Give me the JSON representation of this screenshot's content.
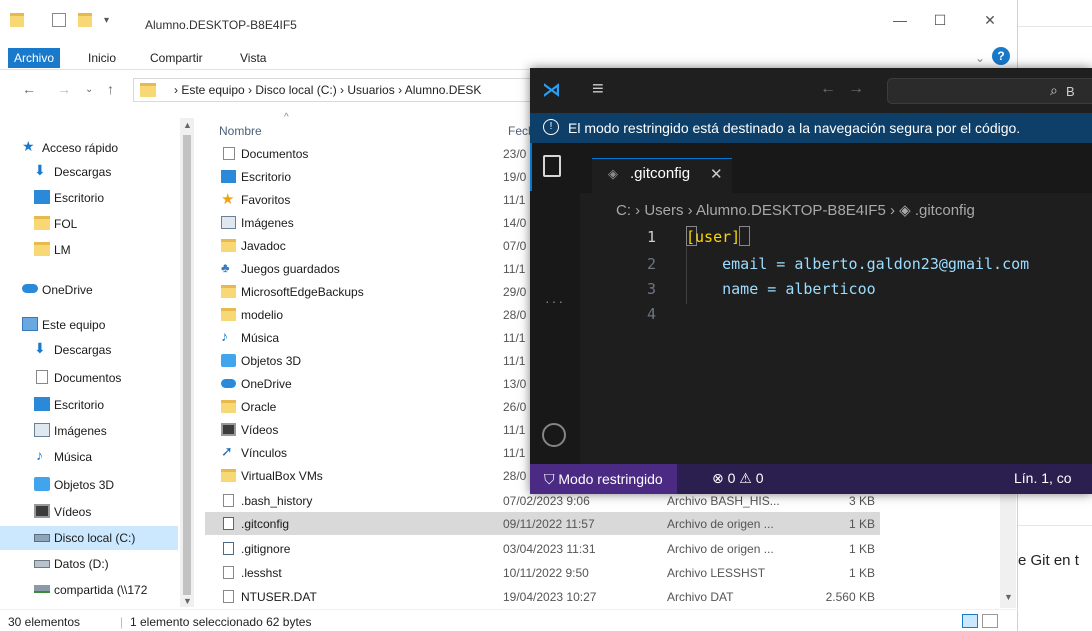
{
  "explorer": {
    "title": "Alumno.DESKTOP-B8E4IF5",
    "ribbon_tabs": [
      "Archivo",
      "Inicio",
      "Compartir",
      "Vista"
    ],
    "address_path": "›  Este equipo  ›  Disco local (C:)  ›  Usuarios  ›  Alumno.DESK",
    "nav": [
      {
        "label": "Acceso rápido",
        "icon": "star-icon"
      },
      {
        "label": "Descargas",
        "icon": "download-icon"
      },
      {
        "label": "Escritorio",
        "icon": "desktop-icon"
      },
      {
        "label": "FOL",
        "icon": "folder-icon"
      },
      {
        "label": "LM",
        "icon": "folder-icon"
      },
      {
        "label": "OneDrive",
        "icon": "cloud-icon"
      },
      {
        "label": "Este equipo",
        "icon": "computer-icon"
      },
      {
        "label": "Descargas",
        "icon": "download-icon"
      },
      {
        "label": "Documentos",
        "icon": "document-icon"
      },
      {
        "label": "Escritorio",
        "icon": "desktop-icon"
      },
      {
        "label": "Imágenes",
        "icon": "image-icon"
      },
      {
        "label": "Música",
        "icon": "music-icon"
      },
      {
        "label": "Objetos 3D",
        "icon": "cube-icon"
      },
      {
        "label": "Vídeos",
        "icon": "video-icon"
      },
      {
        "label": "Disco local (C:)",
        "icon": "drive-icon"
      },
      {
        "label": "Datos (D:)",
        "icon": "drive-icon"
      },
      {
        "label": "compartida (\\\\172",
        "icon": "network-drive-icon"
      }
    ],
    "columns": {
      "name": "Nombre",
      "date": "Fech"
    },
    "files": [
      {
        "name": "Documentos",
        "date": "23/0",
        "type": "",
        "size": "",
        "icon": "document-folder-icon"
      },
      {
        "name": "Escritorio",
        "date": "19/0",
        "type": "",
        "size": "",
        "icon": "desktop-icon"
      },
      {
        "name": "Favoritos",
        "date": "11/1",
        "type": "",
        "size": "",
        "icon": "star-icon"
      },
      {
        "name": "Imágenes",
        "date": "14/0",
        "type": "",
        "size": "",
        "icon": "image-icon"
      },
      {
        "name": "Javadoc",
        "date": "07/0",
        "type": "",
        "size": "",
        "icon": "folder-icon"
      },
      {
        "name": "Juegos guardados",
        "date": "11/1",
        "type": "",
        "size": "",
        "icon": "games-icon"
      },
      {
        "name": "MicrosoftEdgeBackups",
        "date": "29/0",
        "type": "",
        "size": "",
        "icon": "folder-icon"
      },
      {
        "name": "modelio",
        "date": "28/0",
        "type": "",
        "size": "",
        "icon": "folder-icon"
      },
      {
        "name": "Música",
        "date": "11/1",
        "type": "",
        "size": "",
        "icon": "music-icon"
      },
      {
        "name": "Objetos 3D",
        "date": "11/1",
        "type": "",
        "size": "",
        "icon": "cube-icon"
      },
      {
        "name": "OneDrive",
        "date": "13/0",
        "type": "",
        "size": "",
        "icon": "cloud-icon"
      },
      {
        "name": "Oracle",
        "date": "26/0",
        "type": "",
        "size": "",
        "icon": "folder-icon"
      },
      {
        "name": "Vídeos",
        "date": "11/1",
        "type": "",
        "size": "",
        "icon": "video-icon"
      },
      {
        "name": "Vínculos",
        "date": "11/1",
        "type": "",
        "size": "",
        "icon": "link-icon"
      },
      {
        "name": "VirtualBox VMs",
        "date": "28/0",
        "type": "",
        "size": "",
        "icon": "folder-icon"
      },
      {
        "name": ".bash_history",
        "date": "07/02/2023 9:06",
        "type": "Archivo BASH_HIS...",
        "size": "3 KB",
        "icon": "file-icon"
      },
      {
        "name": ".gitconfig",
        "date": "09/11/2022 11:57",
        "type": "Archivo de origen ...",
        "size": "1 KB",
        "icon": "config-file-icon"
      },
      {
        "name": ".gitignore",
        "date": "03/04/2023 11:31",
        "type": "Archivo de origen ...",
        "size": "1 KB",
        "icon": "config-file-icon"
      },
      {
        "name": ".lesshst",
        "date": "10/11/2022 9:50",
        "type": "Archivo LESSHST",
        "size": "1 KB",
        "icon": "file-icon"
      },
      {
        "name": "NTUSER.DAT",
        "date": "19/04/2023 10:27",
        "type": "Archivo DAT",
        "size": "2.560 KB",
        "icon": "file-icon"
      }
    ],
    "status": {
      "count": "30 elementos",
      "selected": "1 elemento seleccionado  62 bytes"
    }
  },
  "browser": {
    "partial_text": "e Git en t"
  },
  "vscode": {
    "search_hint": "B",
    "restricted_banner": "El modo restringido está destinado a la navegación segura por el código.",
    "tab_label": ".gitconfig",
    "breadcrumb": "C: › Users › Alumno.DESKTOP-B8E4IF5 ›  ◈  .gitconfig",
    "lines": [
      {
        "num": "1",
        "text": "[user]"
      },
      {
        "num": "2",
        "text": "    email = alberto.galdon23@gmail.com"
      },
      {
        "num": "3",
        "text": "    name = alberticoo"
      },
      {
        "num": "4",
        "text": ""
      }
    ],
    "status": {
      "mode": "Modo restringido",
      "problems": "⊗ 0 ⚠ 0",
      "position": "Lín. 1, co"
    }
  }
}
